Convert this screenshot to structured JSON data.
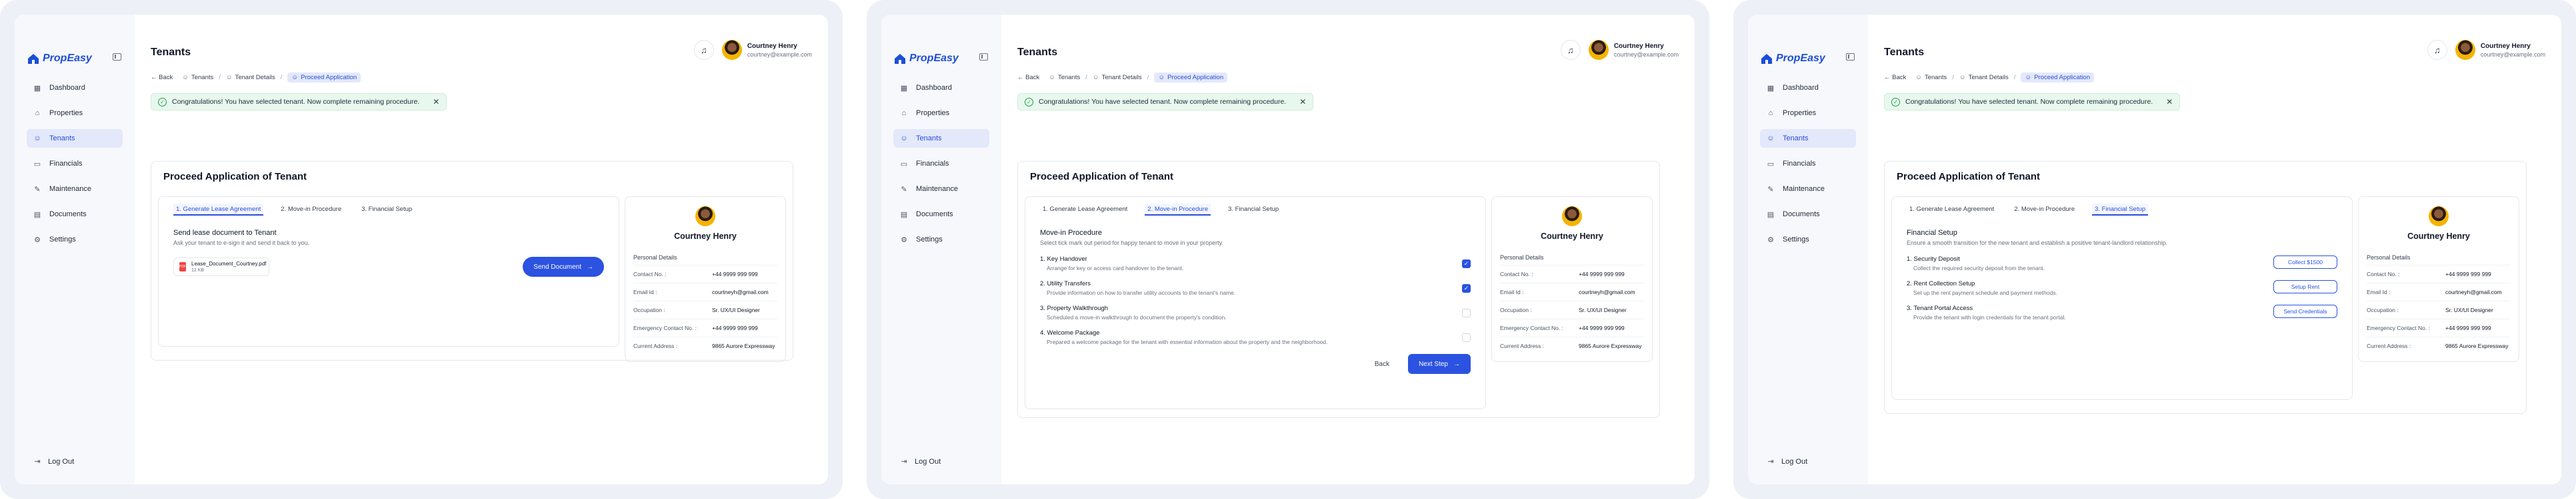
{
  "app": {
    "name": "PropEasy"
  },
  "sidebar": {
    "items": [
      {
        "label": "Dashboard",
        "icon": "dashboard-icon",
        "glyph": "▦"
      },
      {
        "label": "Properties",
        "icon": "properties-icon",
        "glyph": "⌂"
      },
      {
        "label": "Tenants",
        "icon": "tenants-icon",
        "glyph": "☺"
      },
      {
        "label": "Financials",
        "icon": "financials-icon",
        "glyph": "▭"
      },
      {
        "label": "Maintenance",
        "icon": "maintenance-icon",
        "glyph": "✎"
      },
      {
        "label": "Documents",
        "icon": "documents-icon",
        "glyph": "▤"
      },
      {
        "label": "Settings",
        "icon": "settings-icon",
        "glyph": "⚙"
      }
    ],
    "active": "Tenants",
    "logout_label": "Log Out"
  },
  "header": {
    "title": "Tenants",
    "user_name": "Courtney Henry",
    "user_email": "courtney@example.com"
  },
  "breadcrumb": {
    "back": "Back",
    "items": [
      "Tenants",
      "Tenant Details",
      "Proceed Application"
    ]
  },
  "alert": {
    "text": "Congratulations! You have selected tenant. Now complete remaining procedure."
  },
  "panel": {
    "title": "Proceed Application of Tenant"
  },
  "tabs": [
    "1. Generate Lease Agreement",
    "2. Move-in Procedure",
    "3. Financial Setup"
  ],
  "lease": {
    "title": "Send lease document to Tenant",
    "subtitle": "Ask your tenant to e-sign it and send it back to you.",
    "file_name": "Lease_Document_Courtney.pdf",
    "file_size": "12 KB",
    "send_button": "Send Document"
  },
  "move_in": {
    "title": "Move-in Procedure",
    "subtitle": "Select tick mark out period for happy tenant to move in your property.",
    "steps": [
      {
        "title": "1. Key Handover",
        "desc": "Arrange for key or access card handover to the tenant.",
        "checked": true
      },
      {
        "title": "2. Utility Transfers",
        "desc": "Provide information on how to transfer utility accounts to the tenant's name.",
        "checked": true
      },
      {
        "title": "3. Property Walkthrough",
        "desc": "Scheduled a move-in walkthrough to document the property's condition.",
        "checked": false
      },
      {
        "title": "4. Welcome Package",
        "desc": "Prepared a welcome package for the tenant with essential information about the property and the neighborhood.",
        "checked": false
      }
    ],
    "back_button": "Back",
    "next_button": "Next Step"
  },
  "financial": {
    "title": "Financial Setup",
    "subtitle": "Ensure a smooth transition for the new tenant and establish a positive tenant-landlord relationship.",
    "steps": [
      {
        "title": "1. Security Deposit",
        "desc": "Collect the required security deposit from the tenant.",
        "button": "Collect $1500"
      },
      {
        "title": "2. Rent Collection Setup",
        "desc": "Set up the rent payment schedule and payment methods.",
        "button": "Setup Rent"
      },
      {
        "title": "3. Tenant Portal Access",
        "desc": "Provide the tenant with login credentials for the tenant portal.",
        "button": "Send Credentials"
      }
    ]
  },
  "profile": {
    "name": "Courtney Henry",
    "section_title": "Personal Details",
    "rows": [
      {
        "label": "Contact No. :",
        "value": "+44 9999 999 999"
      },
      {
        "label": "Email Id :",
        "value": "courtneyh@gmail.com"
      },
      {
        "label": "Occupation :",
        "value": "Sr. UX/UI Designer"
      },
      {
        "label": "Emergency Contact No. :",
        "value": "+44 9999 999 999"
      },
      {
        "label": "Current Address :",
        "value": "9865 Aurore Expressway"
      }
    ]
  },
  "colors": {
    "accent": "#2b52e0",
    "active_bg": "#e3e8fb",
    "success_bg": "#e9f8ee",
    "frame_bg": "#eef0f7"
  }
}
